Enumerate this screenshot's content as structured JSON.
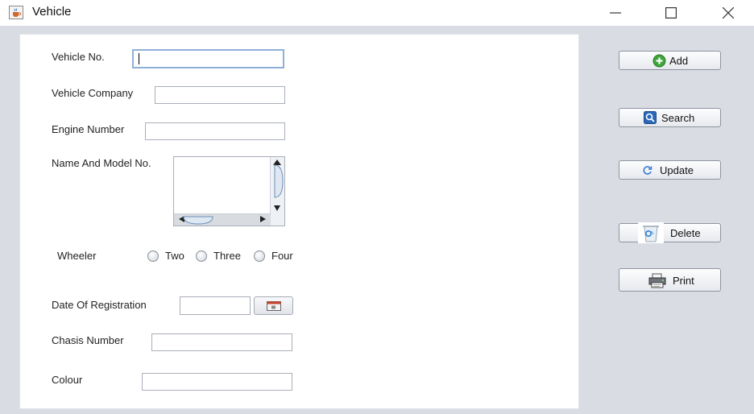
{
  "window": {
    "title": "Vehicle",
    "app_icon": "java-cup-icon",
    "controls": [
      "minimize-icon",
      "maximize-icon",
      "close-icon"
    ]
  },
  "form": {
    "vehicle_no_label": "Vehicle No.",
    "vehicle_no_value": "",
    "vehicle_company_label": "Vehicle Company",
    "vehicle_company_value": "",
    "engine_number_label": "Engine Number",
    "engine_number_value": "",
    "name_model_label": "Name And Model No.",
    "name_model_value": "",
    "wheeler_label": "Wheeler",
    "wheeler_options": [
      "Two",
      "Three",
      "Four"
    ],
    "wheeler_selected": "",
    "date_registration_label": "Date Of Registration",
    "date_registration_value": "",
    "chasis_number_label": "Chasis Number",
    "chasis_number_value": "",
    "colour_label": "Colour",
    "colour_value": ""
  },
  "actions": {
    "add": "Add",
    "search": "Search",
    "update": "Update",
    "delete": "Delete",
    "print": "Print"
  },
  "colors": {
    "frame_bg": "#d9dce3",
    "panel_bg": "#ffffff",
    "focus_border": "#8fb0d6",
    "add_icon": "#3fa53a",
    "search_icon": "#2a67b8"
  }
}
